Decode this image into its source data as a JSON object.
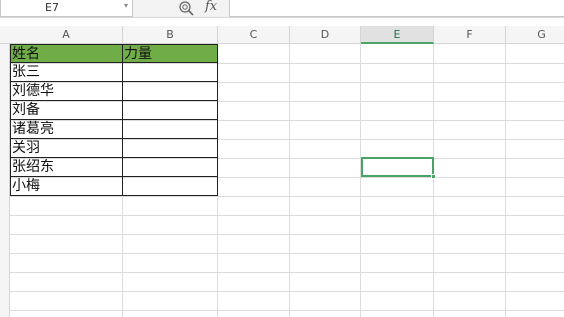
{
  "formula_bar": {
    "name_box": "E7",
    "fx_label": "fx",
    "formula": ""
  },
  "columns": [
    "A",
    "B",
    "C",
    "D",
    "E",
    "F",
    "G"
  ],
  "active_column": "E",
  "table": {
    "headers": [
      "姓名",
      "力量"
    ],
    "rows": [
      [
        "张三",
        ""
      ],
      [
        "刘德华",
        ""
      ],
      [
        "刘备",
        ""
      ],
      [
        "诸葛亮",
        ""
      ],
      [
        "关羽",
        ""
      ],
      [
        "张绍东",
        ""
      ],
      [
        "小梅",
        ""
      ]
    ],
    "header_color": "#70ad47"
  },
  "selection": {
    "cell": "E7",
    "color": "#4aa564"
  },
  "icons": [
    "zoom-icon",
    "fx-icon",
    "dropdown-arrow-icon"
  ]
}
